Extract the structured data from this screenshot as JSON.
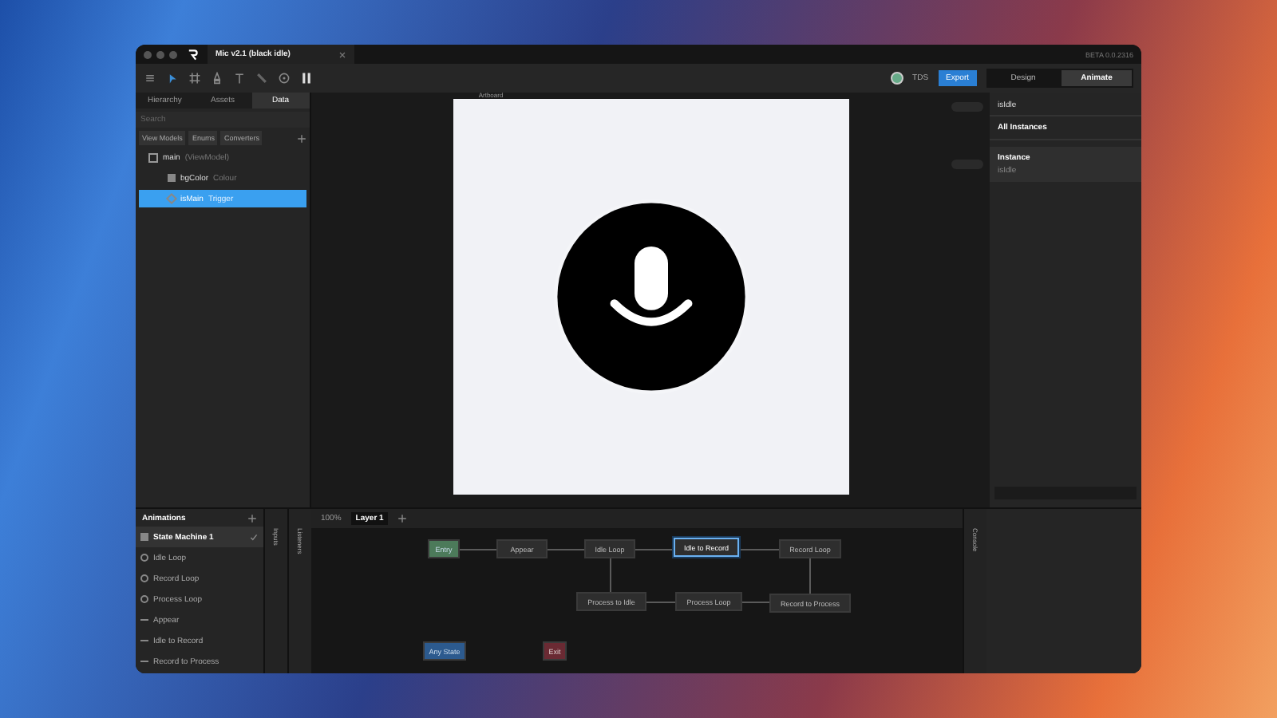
{
  "window": {
    "title": "Mic v2.1 (black idle)",
    "version": "BETA 0.0.2316"
  },
  "toolbar": {
    "user": "TDS",
    "export": "Export",
    "modes": [
      {
        "label": "Design",
        "selected": false
      },
      {
        "label": "Animate",
        "selected": true
      }
    ]
  },
  "left_panel": {
    "tabs": [
      {
        "label": "Hierarchy",
        "selected": false
      },
      {
        "label": "Assets",
        "selected": false
      },
      {
        "label": "Data",
        "selected": true
      }
    ],
    "search": {
      "placeholder": "Search"
    },
    "buttons": [
      "View Models",
      "Enums",
      "Converters"
    ],
    "tree": [
      {
        "name": "main",
        "type": "(ViewModel)",
        "kind": "viewmodel",
        "selected": false,
        "children": [
          {
            "name": "bgColor",
            "type": "Colour",
            "kind": "color",
            "selected": false
          },
          {
            "name": "isMain",
            "type": "Trigger",
            "kind": "trigger",
            "selected": true
          }
        ]
      }
    ]
  },
  "canvas": {
    "artboard_label": "Artboard"
  },
  "right_panel": {
    "header": "isIdle",
    "dropdown": "All Instances",
    "instance_title": "Instance",
    "instance_value": "isIdle"
  },
  "animations": {
    "title": "Animations",
    "items": [
      {
        "label": "State Machine 1",
        "kind": "state-machine",
        "selected": true
      },
      {
        "label": "Idle Loop",
        "kind": "loop",
        "selected": false
      },
      {
        "label": "Record Loop",
        "kind": "loop",
        "selected": false
      },
      {
        "label": "Process Loop",
        "kind": "loop",
        "selected": false
      },
      {
        "label": "Appear",
        "kind": "oneshot",
        "selected": false
      },
      {
        "label": "Idle to Record",
        "kind": "oneshot",
        "selected": false
      },
      {
        "label": "Record to Process",
        "kind": "oneshot",
        "selected": false
      }
    ]
  },
  "side_tabs": [
    "Inputs",
    "Listeners"
  ],
  "graph": {
    "zoom": "100%",
    "layer": "Layer 1",
    "console": "Console",
    "nodes": [
      {
        "label": "Entry",
        "kind": "entry",
        "selected": false
      },
      {
        "label": "Appear",
        "kind": "oneshot",
        "selected": false
      },
      {
        "label": "Idle Loop",
        "kind": "loop",
        "selected": false
      },
      {
        "label": "Idle to Record",
        "kind": "oneshot",
        "selected": true
      },
      {
        "label": "Record Loop",
        "kind": "loop",
        "selected": false
      },
      {
        "label": "Process to Idle",
        "kind": "oneshot",
        "selected": false
      },
      {
        "label": "Process Loop",
        "kind": "loop",
        "selected": false
      },
      {
        "label": "Record to Process",
        "kind": "oneshot",
        "selected": false
      },
      {
        "label": "Any State",
        "kind": "any",
        "selected": false
      },
      {
        "label": "Exit",
        "kind": "exit",
        "selected": false
      }
    ]
  }
}
